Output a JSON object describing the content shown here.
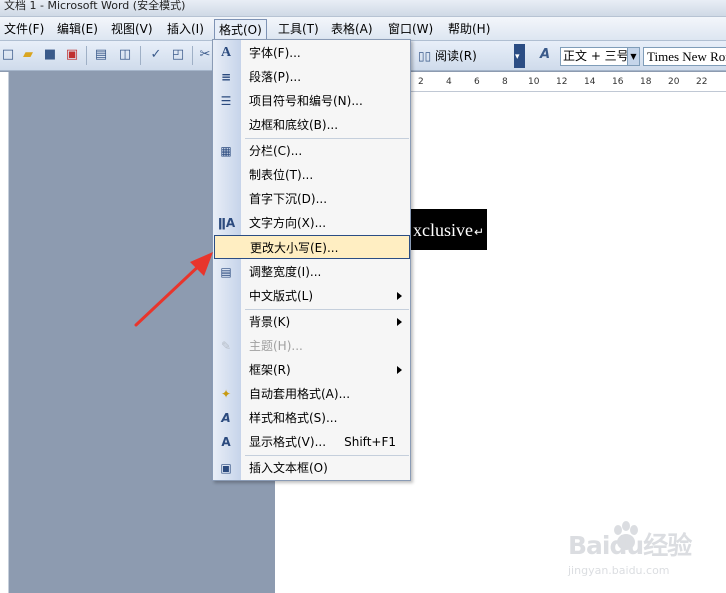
{
  "window": {
    "title": "文档 1 - Microsoft Word (安全模式)"
  },
  "menubar": {
    "items": [
      {
        "label": "文件(F)"
      },
      {
        "label": "编辑(E)"
      },
      {
        "label": "视图(V)"
      },
      {
        "label": "插入(I)"
      },
      {
        "label": "格式(O)"
      },
      {
        "label": "工具(T)"
      },
      {
        "label": "表格(A)"
      },
      {
        "label": "窗口(W)"
      },
      {
        "label": "帮助(H)"
      }
    ]
  },
  "toolbar": {
    "read_label": "阅读(R)",
    "style_value": "正文 + 三号",
    "font_value": "Times New Roman"
  },
  "ruler": {
    "ticks": [
      "2",
      "4",
      "6",
      "8",
      "10",
      "12",
      "14",
      "16",
      "18",
      "20",
      "22"
    ]
  },
  "document": {
    "selected_text": "xclusive",
    "paragraph_mark": "↵"
  },
  "format_menu": {
    "items": [
      {
        "label": "字体(F)...",
        "icon": "font-icon"
      },
      {
        "label": "段落(P)...",
        "icon": "paragraph-icon"
      },
      {
        "label": "项目符号和编号(N)...",
        "icon": "bullets-icon"
      },
      {
        "label": "边框和底纹(B)...",
        "icon": ""
      },
      {
        "label": "分栏(C)...",
        "icon": "columns-icon"
      },
      {
        "label": "制表位(T)...",
        "icon": ""
      },
      {
        "label": "首字下沉(D)...",
        "icon": ""
      },
      {
        "label": "文字方向(X)...",
        "icon": "text-direction-icon"
      },
      {
        "label": "更改大小写(E)...",
        "icon": ""
      },
      {
        "label": "调整宽度(I)...",
        "icon": "adjust-width-icon"
      },
      {
        "label": "中文版式(L)",
        "icon": ""
      },
      {
        "label": "背景(K)",
        "icon": ""
      },
      {
        "label": "主题(H)...",
        "icon": "theme-icon"
      },
      {
        "label": "框架(R)",
        "icon": ""
      },
      {
        "label": "自动套用格式(A)...",
        "icon": "autoformat-icon"
      },
      {
        "label": "样式和格式(S)...",
        "icon": "styles-icon"
      },
      {
        "label": "显示格式(V)...",
        "icon": "reveal-formatting-icon",
        "shortcut": "Shift+F1"
      },
      {
        "label": "插入文本框(O)",
        "icon": "textbox-icon"
      }
    ]
  },
  "watermark": {
    "brand": "Baidu经验",
    "url": "jingyan.baidu.com"
  },
  "colors": {
    "highlight": "#ffeec2",
    "arrow": "#e8352c",
    "menu_border": "#2b4d84"
  }
}
